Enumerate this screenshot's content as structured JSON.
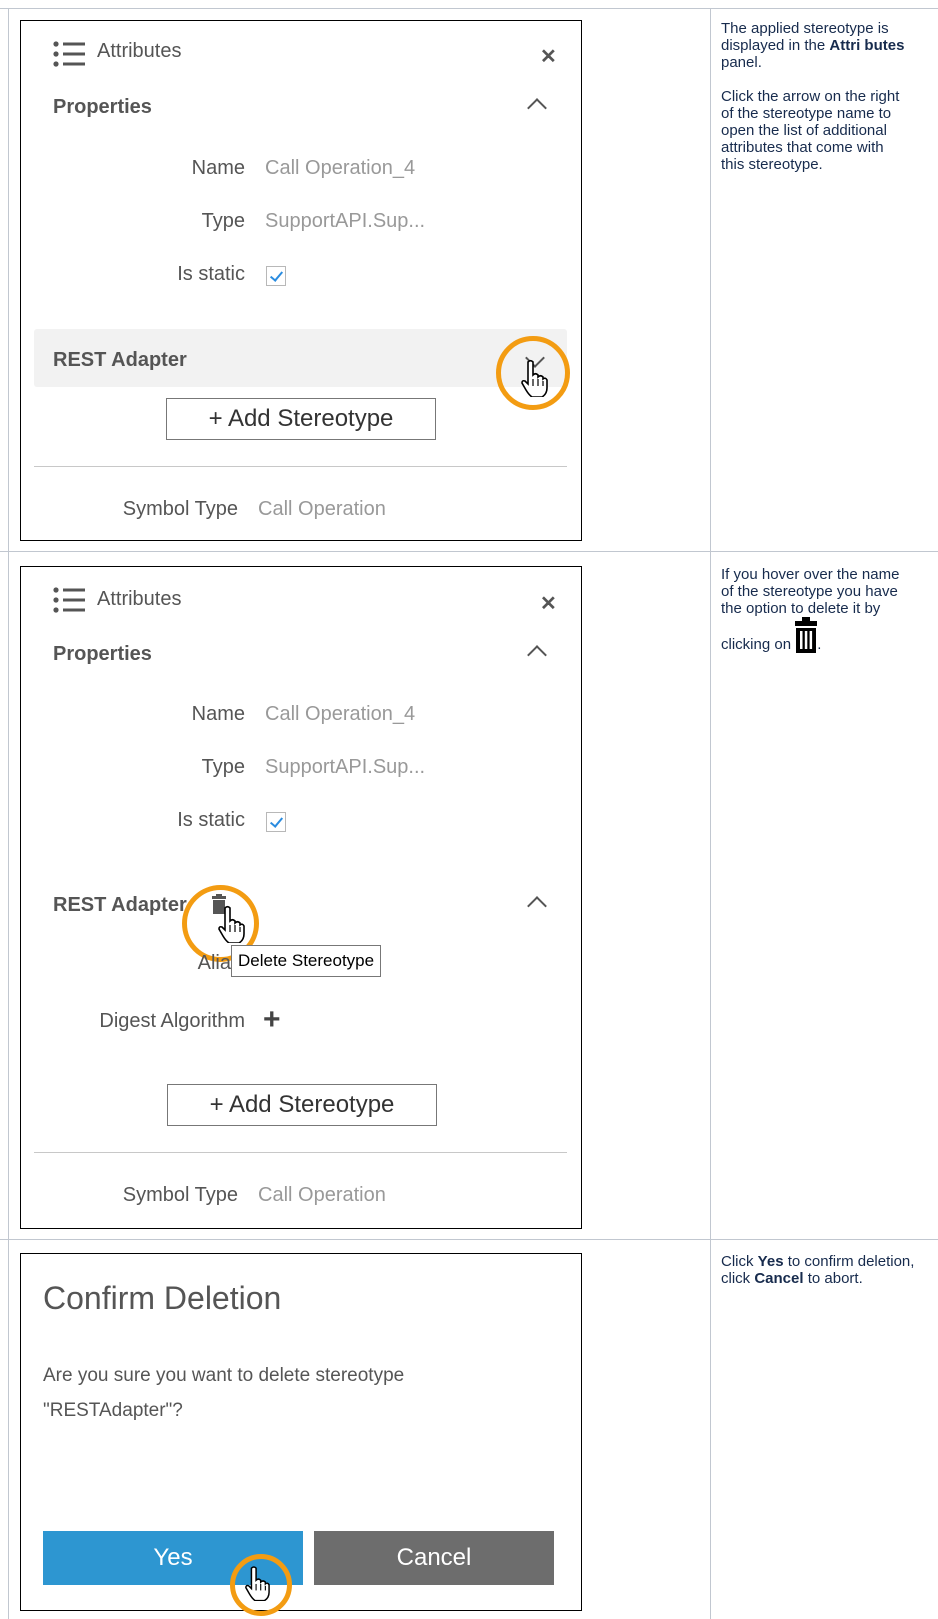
{
  "row1": {
    "panel": {
      "title": "Attributes",
      "properties_heading": "Properties",
      "name_label": "Name",
      "name_value": "Call Operation_4",
      "type_label": "Type",
      "type_value": "SupportAPI.Sup...",
      "is_static_label": "Is static",
      "is_static_checked": true,
      "stereotype_name": "REST Adapter",
      "add_stereotype": "+ Add Stereotype",
      "symbol_type_label": "Symbol Type",
      "symbol_type_value": "Call Operation"
    },
    "description": {
      "p1_a": "The applied stereotype is displayed in the ",
      "p1_b": "Attri butes",
      "p1_c": " panel.",
      "p2": "Click the arrow on the right of the stereotype name to open the list of additional attributes that come with this stereotype."
    }
  },
  "row2": {
    "panel": {
      "title": "Attributes",
      "properties_heading": "Properties",
      "name_label": "Name",
      "name_value": "Call Operation_4",
      "type_label": "Type",
      "type_value": "SupportAPI.Sup...",
      "is_static_label": "Is static",
      "is_static_checked": true,
      "stereotype_name": "REST Adapter",
      "alias_label_partial": "Alia",
      "tooltip": "Delete Stereotype",
      "digest_label": "Digest Algorithm",
      "digest_add": "+",
      "add_stereotype": "+ Add Stereotype",
      "symbol_type_label": "Symbol Type",
      "symbol_type_value": "Call Operation"
    },
    "description": {
      "p1": "If you hover over the name of the stereotype you have the option to delete it by clicking on",
      "p1_end": "."
    }
  },
  "row3": {
    "dialog": {
      "title": "Confirm Deletion",
      "message_line1": "Are you sure you want to delete stereotype",
      "message_line2": "\"RESTAdapter\"?",
      "yes": "Yes",
      "cancel": "Cancel"
    },
    "description": {
      "p1_a": "Click ",
      "p1_b": "Yes",
      "p1_c": " to confirm deletion, click ",
      "p1_d": "Cancel",
      "p1_e": " to abort."
    }
  },
  "colors": {
    "highlight_circle": "#f39c12",
    "yes_button": "#2d96d1",
    "cancel_button": "#6d6d6d",
    "checkbox_tick": "#2a8ce0"
  },
  "icons": [
    "list-icon",
    "close-icon",
    "chevron-up-icon",
    "chevron-down-icon",
    "hand-cursor-icon",
    "trash-icon",
    "checkbox-icon"
  ]
}
